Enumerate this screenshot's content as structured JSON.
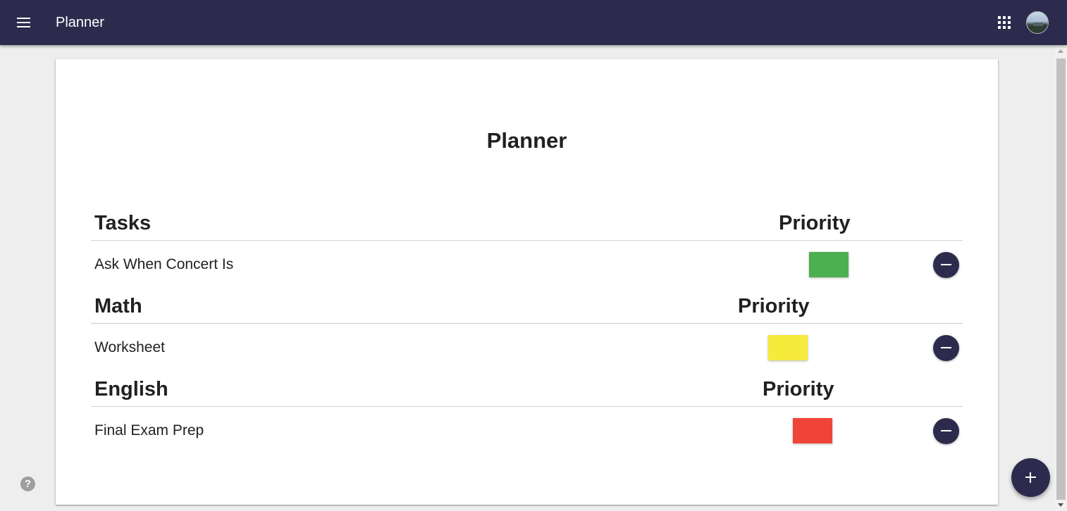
{
  "appbar": {
    "title": "Planner",
    "menu_icon": "menu-icon",
    "apps_icon": "apps-grid-icon",
    "avatar_icon": "user-avatar"
  },
  "page": {
    "title": "Planner"
  },
  "sections": [
    {
      "name": "Tasks",
      "priority_label": "Priority",
      "tasks": [
        {
          "text": "Ask When Concert Is",
          "priority_color": "#4caf50",
          "priority": "low"
        }
      ]
    },
    {
      "name": "Math",
      "priority_label": "Priority",
      "tasks": [
        {
          "text": "Worksheet",
          "priority_color": "#f6eb3c",
          "priority": "medium"
        }
      ]
    },
    {
      "name": "English",
      "priority_label": "Priority",
      "tasks": [
        {
          "text": "Final Exam Prep",
          "priority_color": "#f04438",
          "priority": "high"
        }
      ]
    }
  ],
  "help": {
    "icon": "help-icon",
    "glyph": "?"
  },
  "fab": {
    "icon": "add-icon"
  },
  "colors": {
    "appbar": "#2d2b4d",
    "background": "#eeeeee",
    "card": "#ffffff"
  }
}
